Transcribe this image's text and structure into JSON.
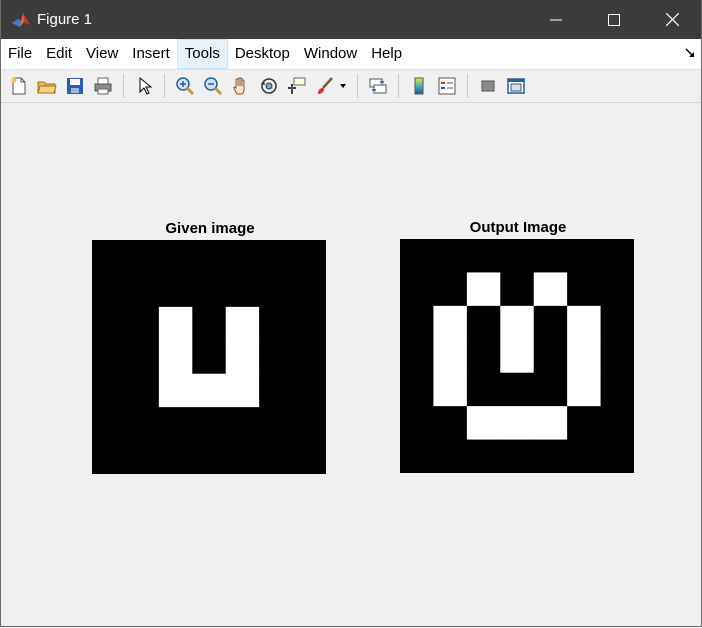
{
  "window": {
    "title": "Figure 1",
    "icon": "matlab-logo-icon",
    "controls": [
      "minimize-icon",
      "maximize-icon",
      "close-icon"
    ]
  },
  "menubar": {
    "items": [
      {
        "label": "File"
      },
      {
        "label": "Edit"
      },
      {
        "label": "View"
      },
      {
        "label": "Insert"
      },
      {
        "label": "Tools",
        "active": true
      },
      {
        "label": "Desktop"
      },
      {
        "label": "Window"
      },
      {
        "label": "Help"
      }
    ]
  },
  "toolbar": {
    "groups": [
      [
        "new-figure-icon",
        "open-file-icon",
        "save-icon",
        "print-icon"
      ],
      [
        "edit-plot-arrow-icon"
      ],
      [
        "zoom-in-icon",
        "zoom-out-icon",
        "pan-hand-icon",
        "rotate-3d-icon",
        "data-cursor-icon",
        "brush-icon"
      ],
      [
        "link-plot-icon"
      ],
      [
        "colorbar-icon",
        "legend-icon"
      ],
      [
        "hide-plot-tools-icon",
        "show-plot-tools-icon"
      ]
    ]
  },
  "plots": [
    {
      "title": "Given image",
      "rows": 7,
      "cols": 7,
      "pixels": [
        [
          0,
          0,
          0,
          0,
          0,
          0,
          0
        ],
        [
          0,
          0,
          0,
          0,
          0,
          0,
          0
        ],
        [
          0,
          0,
          1,
          0,
          1,
          0,
          0
        ],
        [
          0,
          0,
          1,
          0,
          1,
          0,
          0
        ],
        [
          0,
          0,
          1,
          1,
          1,
          0,
          0
        ],
        [
          0,
          0,
          0,
          0,
          0,
          0,
          0
        ],
        [
          0,
          0,
          0,
          0,
          0,
          0,
          0
        ]
      ]
    },
    {
      "title": "Output Image",
      "rows": 7,
      "cols": 7,
      "pixels": [
        [
          0,
          0,
          0,
          0,
          0,
          0,
          0
        ],
        [
          0,
          0,
          1,
          0,
          1,
          0,
          0
        ],
        [
          0,
          1,
          0,
          1,
          0,
          1,
          0
        ],
        [
          0,
          1,
          0,
          1,
          0,
          1,
          0
        ],
        [
          0,
          1,
          0,
          0,
          0,
          1,
          0
        ],
        [
          0,
          0,
          1,
          1,
          1,
          0,
          0
        ],
        [
          0,
          0,
          0,
          0,
          0,
          0,
          0
        ]
      ]
    }
  ]
}
